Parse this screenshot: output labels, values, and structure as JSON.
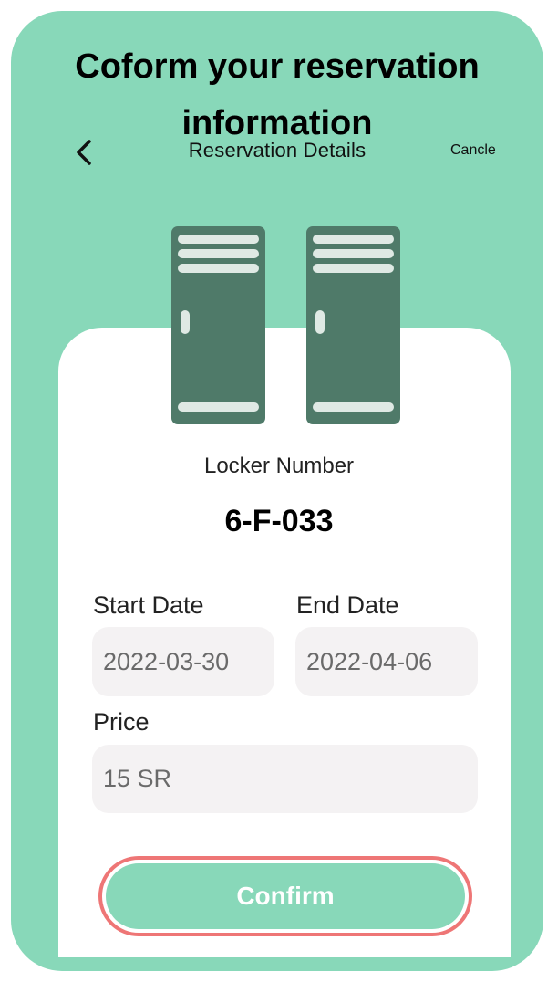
{
  "header": {
    "headline": "Coform your reservation information",
    "title": "Reservation Details",
    "back_icon": "chevron-left-icon",
    "cancel_label": "Cancle"
  },
  "locker": {
    "label": "Locker Number",
    "number": "6-F-033",
    "icon": "locker-icon"
  },
  "form": {
    "start_date": {
      "label": "Start Date",
      "value": "2022-03-30"
    },
    "end_date": {
      "label": "End Date",
      "value": "2022-04-06"
    },
    "price": {
      "label": "Price",
      "value": "15 SR"
    }
  },
  "actions": {
    "confirm_label": "Confirm"
  },
  "colors": {
    "accent": "#88d8b9",
    "locker": "#4f7a69",
    "field_bg": "#f4f2f3",
    "confirm_border": "#ee7676"
  }
}
